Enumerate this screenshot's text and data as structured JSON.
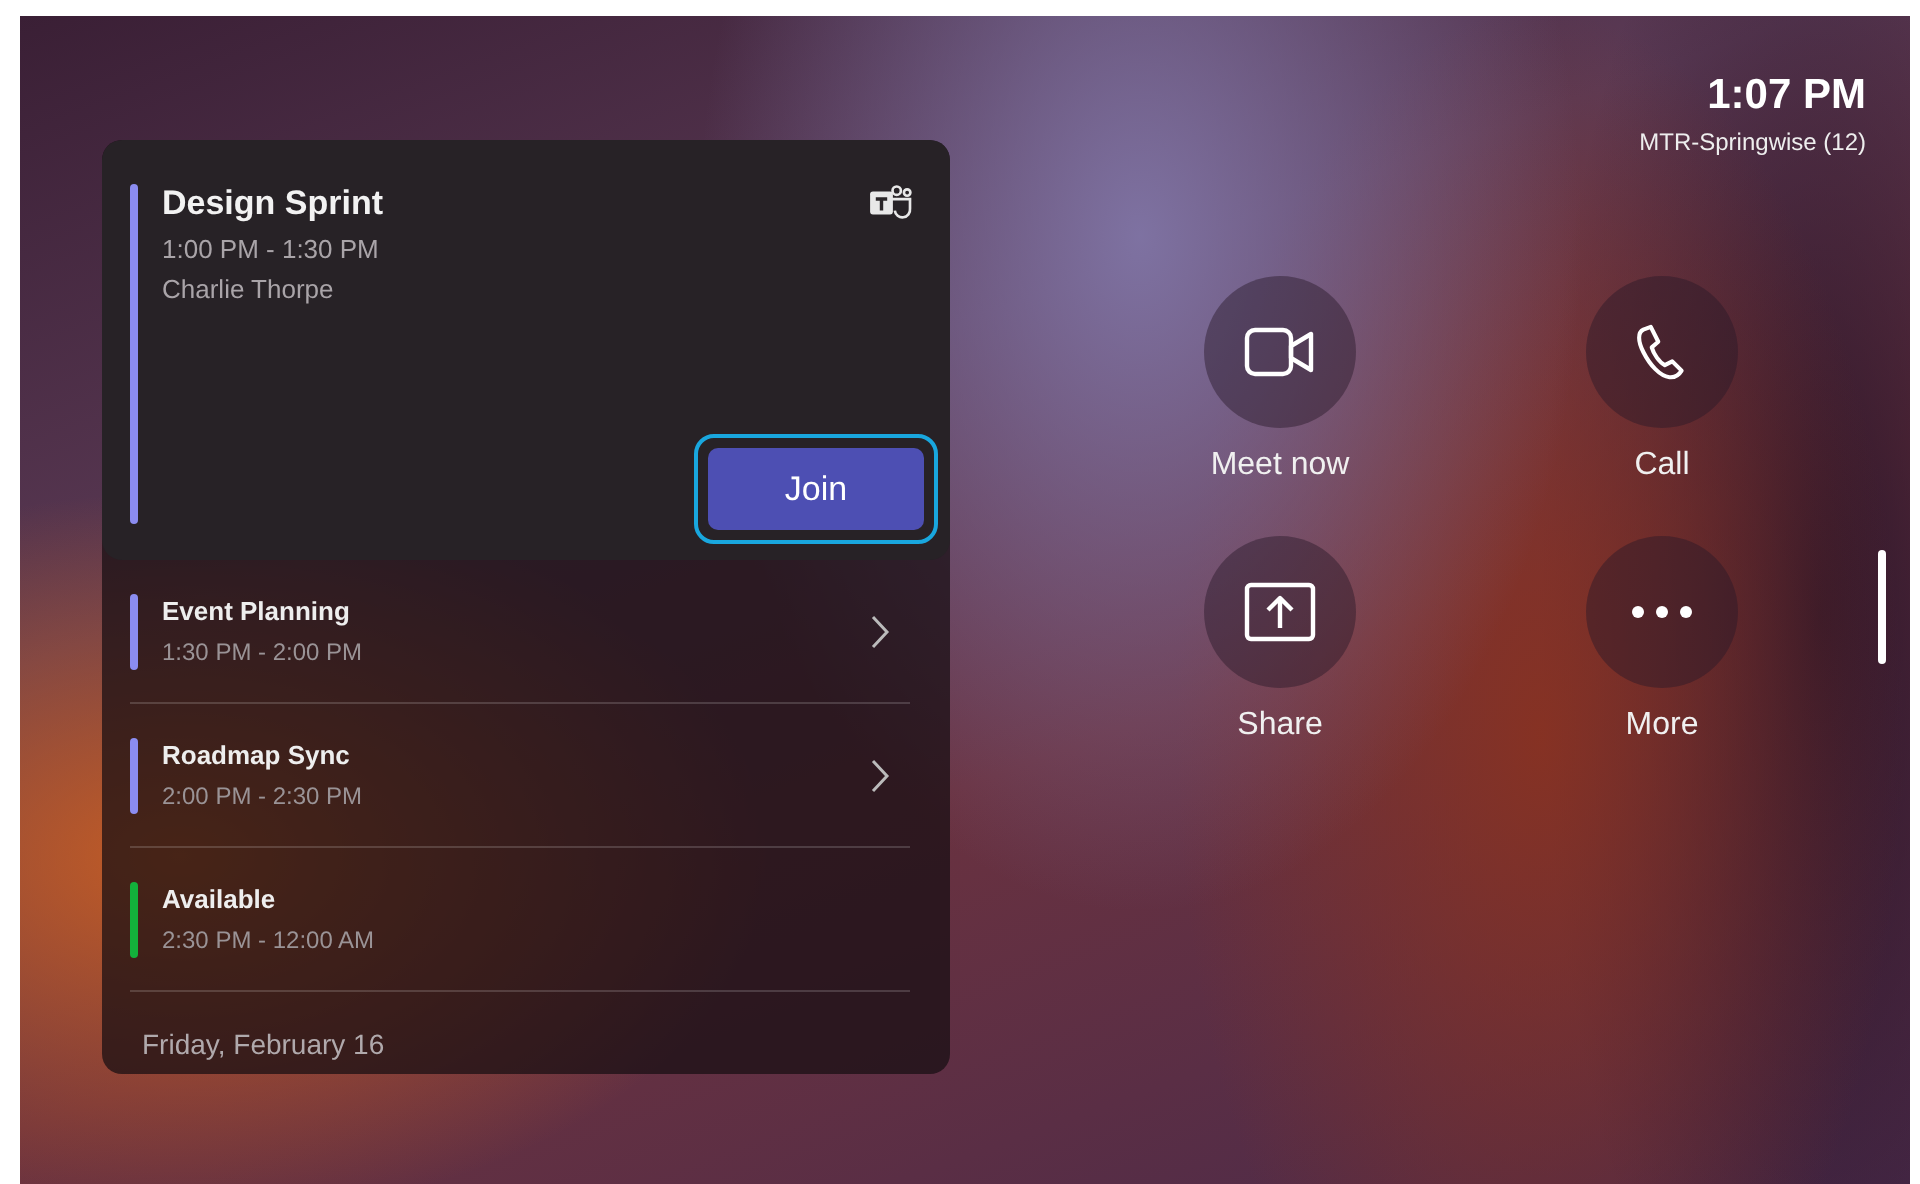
{
  "status": {
    "time": "1:07 PM",
    "room": "MTR-Springwise (12)"
  },
  "featured_meeting": {
    "title": "Design Sprint",
    "time": "1:00 PM - 1:30 PM",
    "organizer": "Charlie Thorpe",
    "color": "#8b8cf0",
    "join_button": {
      "label": "Join",
      "focused": true
    }
  },
  "agenda": [
    {
      "title": "Event Planning",
      "time": "1:30 PM - 2:00 PM",
      "color": "#8b8cf0",
      "has_details": true
    },
    {
      "title": "Roadmap Sync",
      "time": "2:00 PM - 2:30 PM",
      "color": "#8b8cf0",
      "has_details": true
    },
    {
      "title": "Available",
      "time": "2:30 PM - 12:00 AM",
      "color": "#13b13b",
      "has_details": false
    }
  ],
  "date": "Friday, February 16",
  "actions": [
    {
      "kind": "video",
      "label": "Meet now"
    },
    {
      "kind": "phone",
      "label": "Call"
    },
    {
      "kind": "share",
      "label": "Share"
    },
    {
      "kind": "more",
      "label": "More"
    }
  ]
}
